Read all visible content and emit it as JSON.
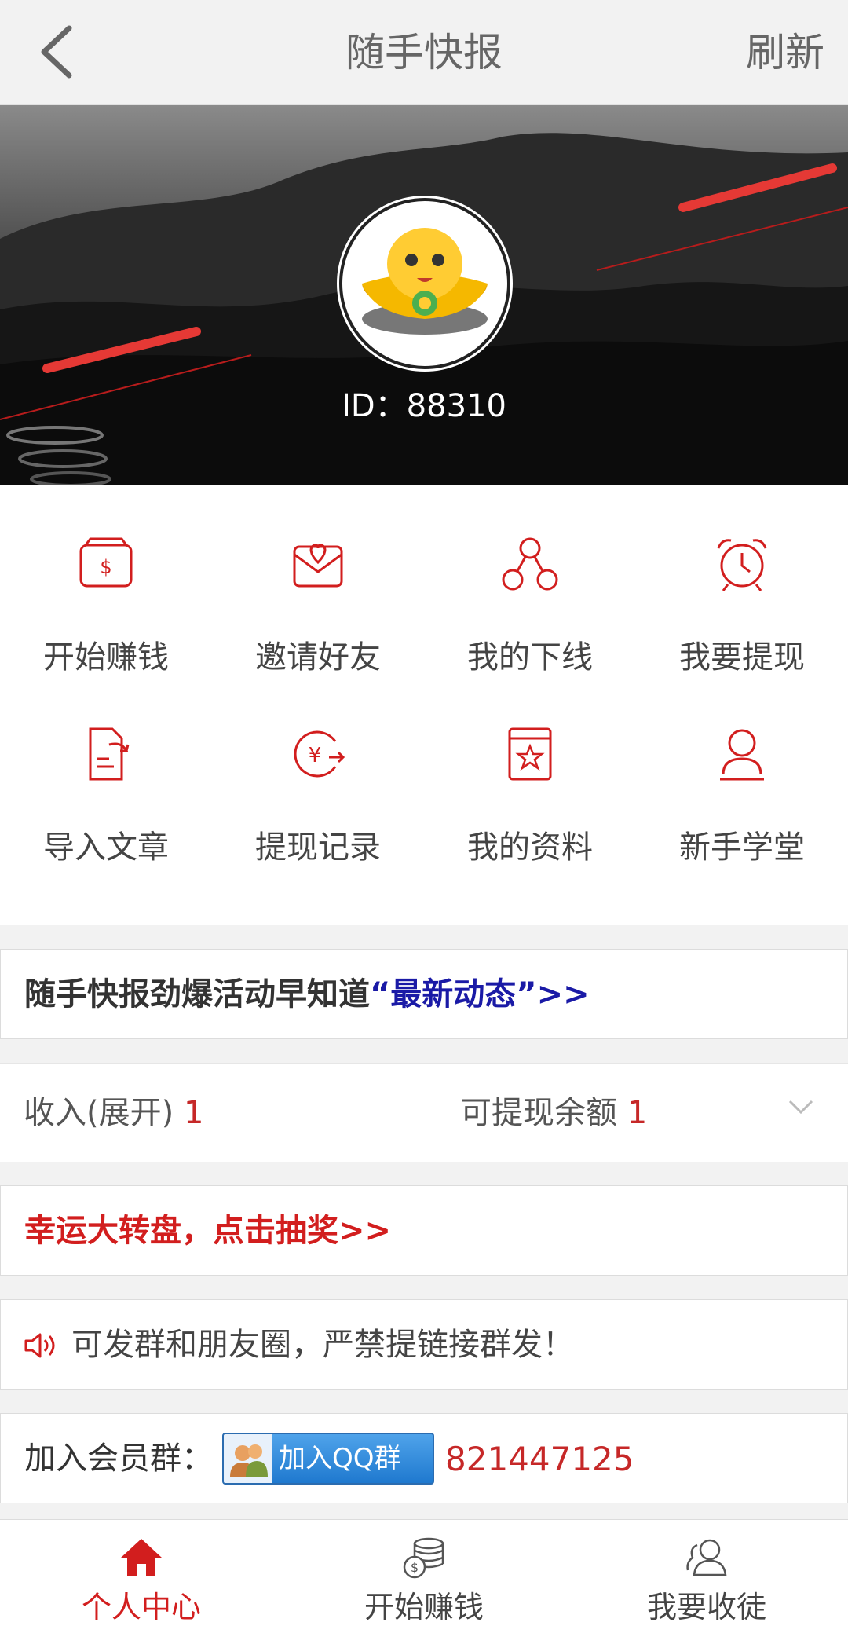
{
  "header": {
    "title": "随手快报",
    "refresh_label": "刷新"
  },
  "profile": {
    "id_text": "ID：88310"
  },
  "menu": [
    {
      "label": "开始赚钱",
      "icon": "wallet-icon"
    },
    {
      "label": "邀请好友",
      "icon": "heart-envelope-icon"
    },
    {
      "label": "我的下线",
      "icon": "network-icon"
    },
    {
      "label": "我要提现",
      "icon": "alarm-clock-icon"
    },
    {
      "label": "导入文章",
      "icon": "import-document-icon"
    },
    {
      "label": "提现记录",
      "icon": "yen-record-icon"
    },
    {
      "label": "我的资料",
      "icon": "profile-book-icon"
    },
    {
      "label": "新手学堂",
      "icon": "user-icon"
    }
  ],
  "news": {
    "prefix": "随手快报劲爆活动早知道",
    "link": "“最新动态”>>"
  },
  "income": {
    "label": "收入(展开)",
    "value": "1",
    "balance_label": "可提现余额",
    "balance_value": "1"
  },
  "lottery": {
    "label": "幸运大转盘，点击抽奖>>"
  },
  "notice": {
    "text": "可发群和朋友圈，严禁提链接群发！"
  },
  "group": {
    "label": "加入会员群：",
    "qq_button": "加入QQ群",
    "number": "821447125"
  },
  "tabs": [
    {
      "label": "个人中心",
      "icon": "home-icon",
      "active": true
    },
    {
      "label": "开始赚钱",
      "icon": "coins-icon",
      "active": false
    },
    {
      "label": "我要收徒",
      "icon": "users-icon",
      "active": false
    }
  ],
  "colors": {
    "accent": "#d21e1e",
    "link_blue": "#1a1aa6",
    "number_red": "#c62828"
  }
}
